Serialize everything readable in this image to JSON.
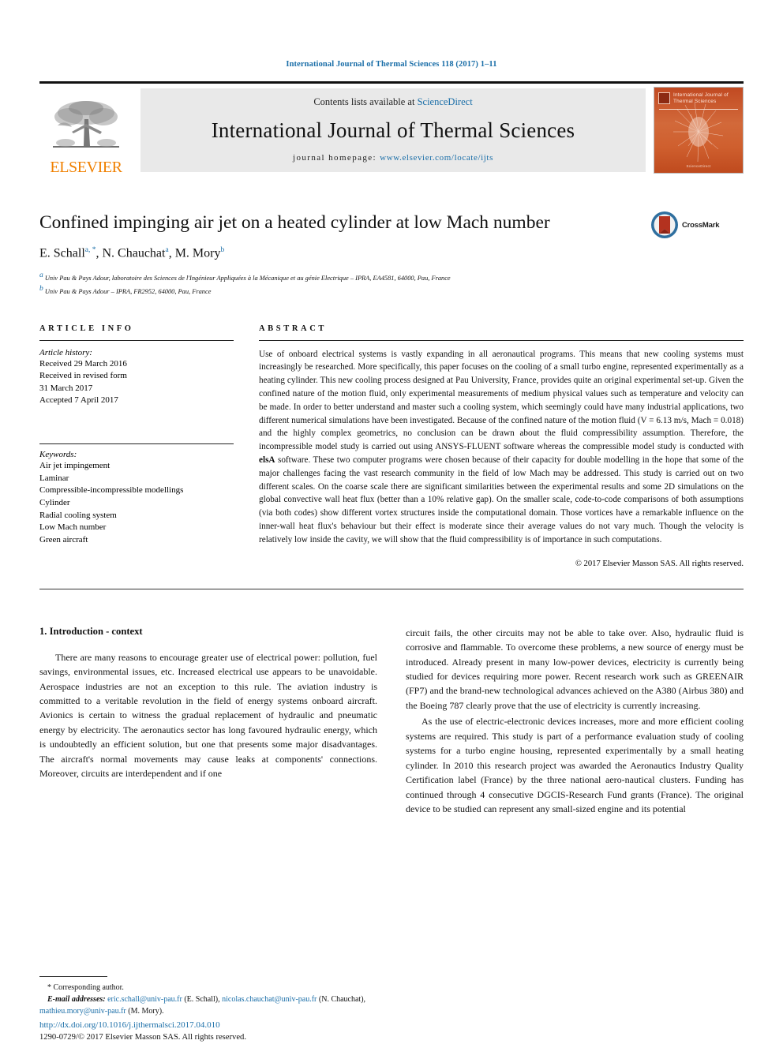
{
  "running_head": "International Journal of Thermal Sciences 118 (2017) 1–11",
  "masthead": {
    "publisher": "ELSEVIER",
    "contents_prefix": "Contents lists available at ",
    "contents_link": "ScienceDirect",
    "journal_title": "International Journal of Thermal Sciences",
    "homepage_prefix": "journal homepage: ",
    "homepage_url": "www.elsevier.com/locate/ijts",
    "cover_title": "International Journal of Thermal Sciences",
    "cover_footer": "ScienceDirect"
  },
  "article": {
    "title": "Confined impinging air jet on a heated cylinder at low Mach number",
    "authors": [
      {
        "name": "E. Schall",
        "marks": "a, *"
      },
      {
        "name": "N. Chauchat",
        "marks": "a"
      },
      {
        "name": "M. Mory",
        "marks": "b"
      }
    ],
    "affiliations": [
      {
        "mark": "a",
        "text": "Univ Pau & Pays Adour, laboratoire des Sciences de l'Ingénieur Appliquées à la Mécanique et au génie Electrique – IPRA, EA4581, 64000, Pau, France"
      },
      {
        "mark": "b",
        "text": "Univ Pau & Pays Adour – IPRA, FR2952, 64000, Pau, France"
      }
    ],
    "crossmark_label": "CrossMark"
  },
  "article_info": {
    "heading": "ARTICLE INFO",
    "history_label": "Article history:",
    "history": [
      "Received 29 March 2016",
      "Received in revised form",
      "31 March 2017",
      "Accepted 7 April 2017"
    ],
    "keywords_label": "Keywords:",
    "keywords": [
      "Air jet impingement",
      "Laminar",
      "Compressible-incompressible modellings",
      "Cylinder",
      "Radial cooling system",
      "Low Mach number",
      "Green aircraft"
    ]
  },
  "abstract": {
    "heading": "ABSTRACT",
    "text_part1": "Use of onboard electrical systems is vastly expanding in all aeronautical programs. This means that new cooling systems must increasingly be researched. More specifically, this paper focuses on the cooling of a small turbo engine, represented experimentally as a heating cylinder. This new cooling process designed at Pau University, France, provides quite an original experimental set-up. Given the confined nature of the motion fluid, only experimental measurements of medium physical values such as temperature and velocity can be made. In order to better understand and master such a cooling system, which seemingly could have many industrial applications, two different numerical simulations have been investigated. Because of the confined nature of the motion fluid (V = 6.13 m/s, Mach = 0.018) and the highly complex geometrics, no conclusion can be drawn about the fluid compressibility assumption. Therefore, the incompressible model study is carried out using ANSYS-FLUENT software whereas the compressible model study is conducted with ",
    "software_name": "elsA",
    "text_part2": " software. These two computer programs were chosen because of their capacity for double modelling in the hope that some of the major challenges facing the vast research community in the field of low Mach may be addressed. This study is carried out on two different scales. On the coarse scale there are significant similarities between the experimental results and some 2D simulations on the global convective wall heat flux (better than a 10% relative gap). On the smaller scale, code-to-code comparisons of both assumptions (via both codes) show different vortex structures inside the computational domain. Those vortices have a remarkable influence on the inner-wall heat flux's behaviour but their effect is moderate since their average values do not vary much. Though the velocity is relatively low inside the cavity, we will show that the fluid compressibility is of importance in such computations.",
    "copyright": "© 2017 Elsevier Masson SAS. All rights reserved."
  },
  "body": {
    "section_heading": "1. Introduction - context",
    "left_para1": "There are many reasons to encourage greater use of electrical power: pollution, fuel savings, environmental issues, etc. Increased electrical use appears to be unavoidable. Aerospace industries are not an exception to this rule. The aviation industry is committed to a veritable revolution in the field of energy systems onboard aircraft. Avionics is certain to witness the gradual replacement of hydraulic and pneumatic energy by electricity. The aeronautics sector has long favoured hydraulic energy, which is undoubtedly an efficient solution, but one that presents some major disadvantages. The aircraft's normal movements may cause leaks at components' connections. Moreover, circuits are interdependent and if one",
    "right_para1": "circuit fails, the other circuits may not be able to take over. Also, hydraulic fluid is corrosive and flammable. To overcome these problems, a new source of energy must be introduced. Already present in many low-power devices, electricity is currently being studied for devices requiring more power. Recent research work such as GREENAIR (FP7) and the brand-new technological advances achieved on the A380 (Airbus 380) and the Boeing 787 clearly prove that the use of electricity is currently increasing.",
    "right_para2": "As the use of electric-electronic devices increases, more and more efficient cooling systems are required. This study is part of a performance evaluation study of cooling systems for a turbo engine housing, represented experimentally by a small heating cylinder. In 2010 this research project was awarded the Aeronautics Industry Quality Certification label (France) by the three national aero-nautical clusters. Funding has continued through 4 consecutive DGCIS-Research Fund grants (France). The original device to be studied can represent any small-sized engine and its potential"
  },
  "footnotes": {
    "corresponding": "Corresponding author.",
    "email_label": "E-mail addresses:",
    "emails": [
      {
        "address": "eric.schall@univ-pau.fr",
        "owner": "(E. Schall)"
      },
      {
        "address": "nicolas.chauchat@univ-pau.fr",
        "owner": "(N. Chauchat)"
      },
      {
        "address": "mathieu.mory@univ-pau.fr",
        "owner": "(M. Mory)"
      }
    ],
    "doi": "http://dx.doi.org/10.1016/j.ijthermalsci.2017.04.010",
    "issn": "1290-0729/© 2017 Elsevier Masson SAS. All rights reserved."
  },
  "colors": {
    "link": "#1a6ea8",
    "elsevier_orange": "#F08000",
    "cover_orange": "#c14a22"
  }
}
